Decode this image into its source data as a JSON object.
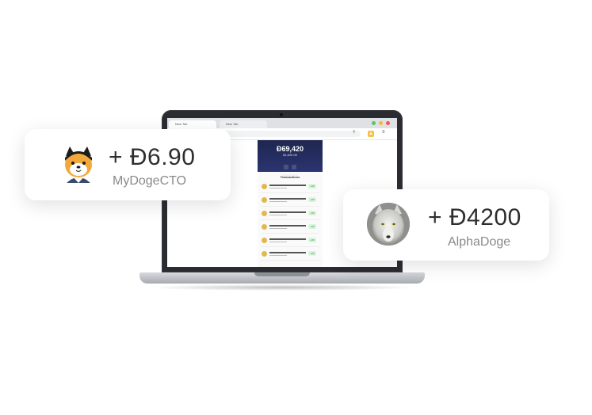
{
  "browser": {
    "tabs": [
      {
        "label": "New Tab"
      },
      {
        "label": "New Tab"
      }
    ],
    "extension_icon": "doge-paw-icon",
    "menu_icon": "hamburger-menu-icon"
  },
  "wallet": {
    "balance": "Đ69,420",
    "usd_balance": "$1,600.00",
    "actions": [
      "Receive",
      "Send"
    ],
    "transactions_title": "Transactions",
    "transactions": [
      {
        "amount": "+69"
      },
      {
        "amount": "+69"
      },
      {
        "amount": "+69"
      },
      {
        "amount": "+69"
      },
      {
        "amount": "+69"
      },
      {
        "amount": "+69"
      }
    ]
  },
  "cards": [
    {
      "amount": "+ Đ6.90",
      "name": "MyDogeCTO",
      "avatar": "shiba-avatar-icon"
    },
    {
      "amount": "+ Đ4200",
      "name": "AlphaDoge",
      "avatar": "wolf-avatar-icon"
    }
  ],
  "colors": {
    "wallet_header": "#1e2650",
    "coin": "#e1b84c",
    "accent_yellow": "#f6c343",
    "tx_green": "#2a8a3a"
  }
}
